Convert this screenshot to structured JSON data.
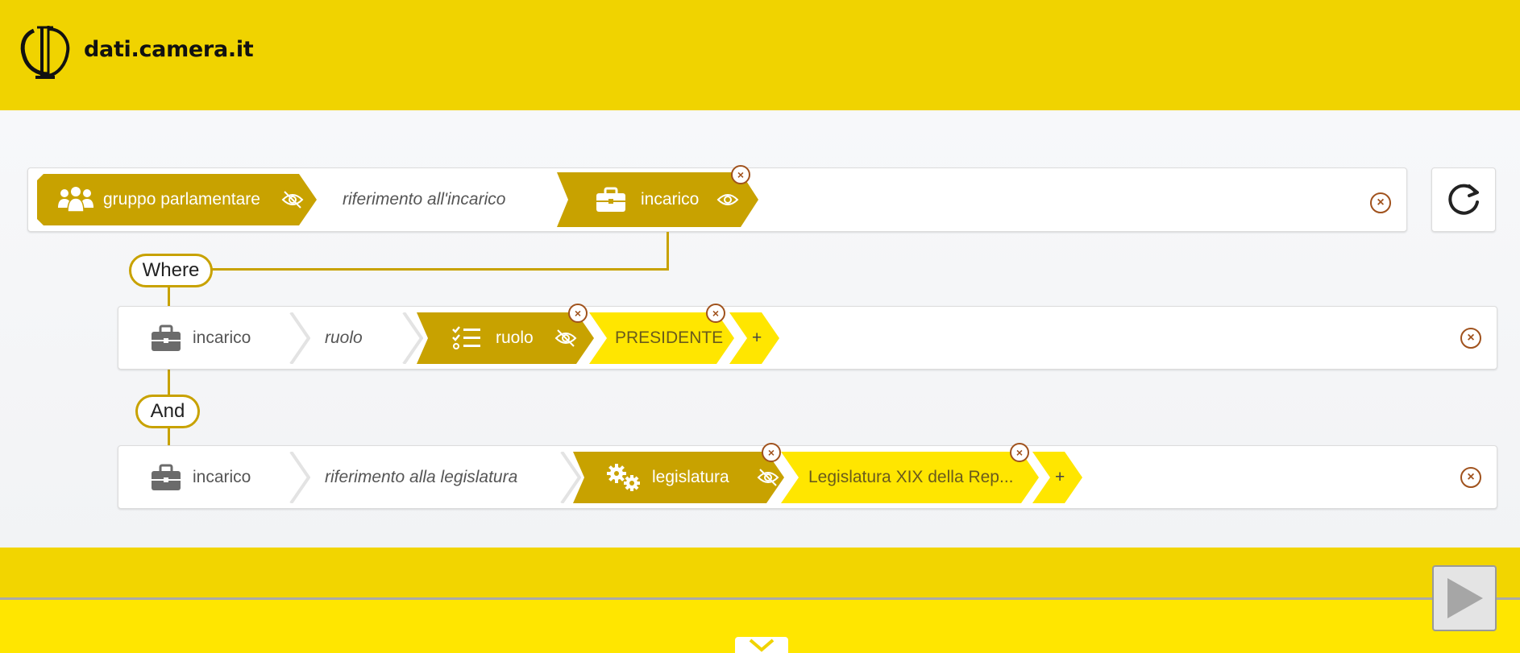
{
  "header": {
    "site_name": "dati.camera.it"
  },
  "query": {
    "main_row": {
      "subject": "gruppo parlamentare",
      "predicate": "riferimento all'incarico",
      "object": "incarico"
    },
    "where_label": "Where",
    "and_label": "And",
    "filter_rows": [
      {
        "subject": "incarico",
        "predicate": "ruolo",
        "object": "ruolo",
        "value": "PRESIDENTE",
        "add_label": "+"
      },
      {
        "subject": "incarico",
        "predicate": "riferimento alla legislatura",
        "object": "legislatura",
        "value": "Legislatura XIX della Rep...",
        "add_label": "+"
      }
    ],
    "close_glyph": "×"
  },
  "colors": {
    "header_yellow": "#f0d300",
    "chip_dark": "#c8a200",
    "chip_yellow": "#ffe600",
    "close_brown": "#a0521d"
  },
  "icons": [
    "group-icon",
    "eye-off-icon",
    "briefcase-icon",
    "eye-icon",
    "list-check-icon",
    "gears-icon",
    "refresh-icon",
    "play-icon",
    "chevron-down-icon"
  ]
}
